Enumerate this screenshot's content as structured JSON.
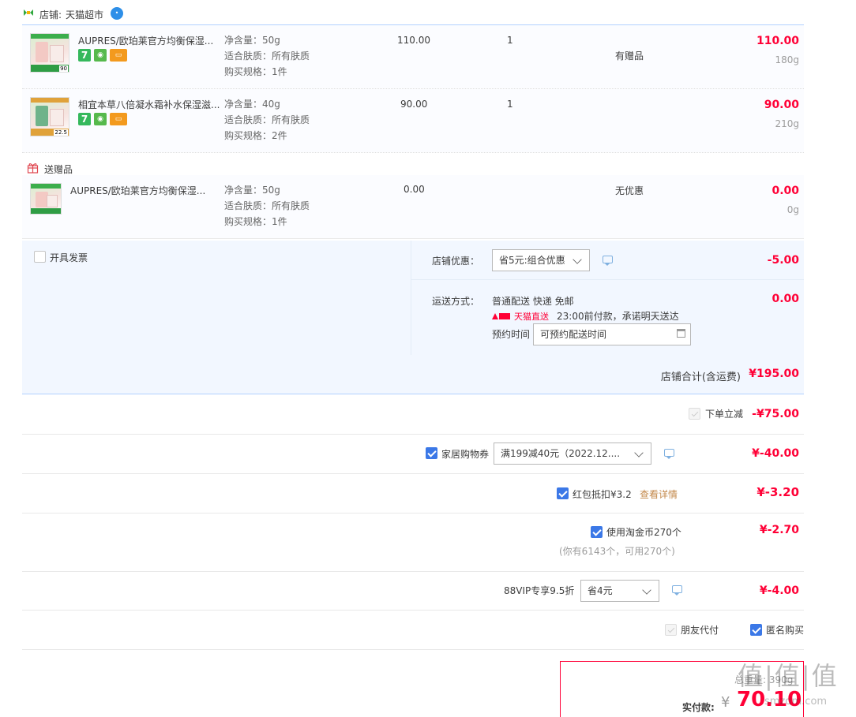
{
  "store": {
    "label": "店铺:",
    "name": "天猫超市"
  },
  "items": [
    {
      "title": "AUPRES/欧珀莱官方均衡保湿...",
      "sku": [
        "净含量：50g",
        "适合肤质：所有肤质",
        "购买规格：1件"
      ],
      "unit_price": "110.00",
      "qty": "1",
      "promo": "有赠品",
      "subtotal": "110.00",
      "weight": "180g",
      "thumb_num": "90"
    },
    {
      "title": "相宜本草八倍凝水霜补水保湿滋...",
      "sku": [
        "净含量：40g",
        "适合肤质：所有肤质",
        "购买规格：2件"
      ],
      "unit_price": "90.00",
      "qty": "1",
      "promo": "",
      "subtotal": "90.00",
      "weight": "210g",
      "thumb_num": "22.5"
    }
  ],
  "badges": {
    "seven": "7"
  },
  "gift": {
    "header": "送赠品",
    "title": "AUPRES/欧珀莱官方均衡保湿...",
    "sku": [
      "净含量：50g",
      "适合肤质：所有肤质",
      "购买规格：1件"
    ],
    "unit_price": "0.00",
    "promo": "无优惠",
    "subtotal": "0.00",
    "weight": "0g"
  },
  "invoice": {
    "label": "开具发票"
  },
  "shop_discount": {
    "label": "店铺优惠：",
    "selected": "省5元:组合优惠",
    "amount": "-5.00"
  },
  "shipping": {
    "label": "运送方式：",
    "method": "普通配送 快递 免邮",
    "tmall_direct": "天猫直送",
    "promise": "23:00前付款，承诺明天送达",
    "schedule_label": "预约时间",
    "schedule_value": "可预约配送时间",
    "amount": "0.00"
  },
  "store_total": {
    "label": "店铺合计(含运费)",
    "amount": "¥195.00"
  },
  "instant_discount": {
    "label": "下单立减",
    "amount": "-¥75.00"
  },
  "home_coupon": {
    "label": "家居购物券",
    "selected": "满199减40元（2022.12....",
    "amount": "¥-40.00"
  },
  "red_packet": {
    "label": "红包抵扣¥3.2",
    "link": "查看详情",
    "amount": "¥-3.20"
  },
  "taojinbi": {
    "label": "使用淘金币270个",
    "note": "(你有6143个，可用270个)",
    "amount": "¥-2.70"
  },
  "vip": {
    "label": "88VIP专享9.5折",
    "selected": "省4元",
    "amount": "¥-4.00"
  },
  "options": {
    "friend_pay": "朋友代付",
    "anonymous": "匿名购买"
  },
  "payment": {
    "total_partial": "总重量: 390g",
    "label": "实付款:",
    "currency": "¥",
    "amount": "70.10"
  },
  "watermark": {
    "text": "值|值|值",
    "url": "smzdm.com"
  },
  "colors": {
    "price_red": "#ff0036",
    "accent_blue": "#3b78e7",
    "border_blue": "#b2d1ff"
  }
}
